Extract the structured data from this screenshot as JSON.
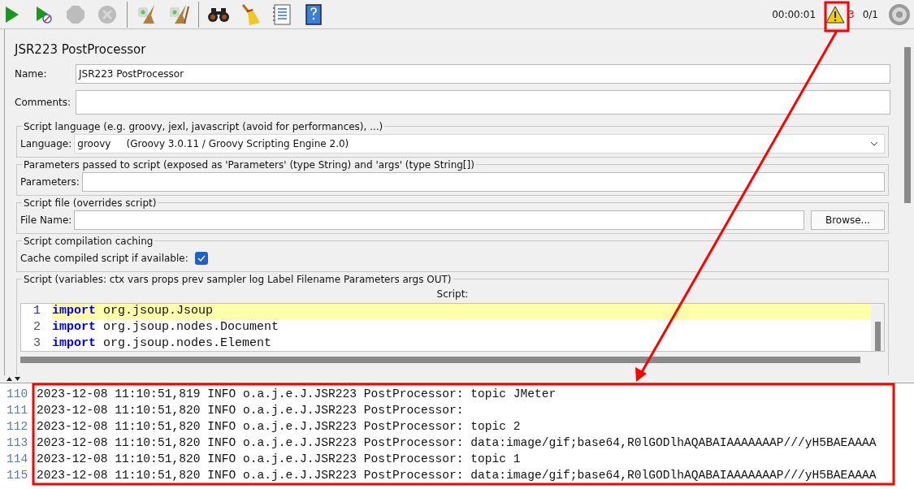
{
  "toolbar": {
    "buttons": [
      {
        "kind": "start",
        "disabled": false
      },
      {
        "kind": "start-no-pauses",
        "disabled": false
      },
      {
        "kind": "stop",
        "disabled": true
      },
      {
        "kind": "shutdown",
        "disabled": true
      },
      {
        "kind": "clear",
        "disabled": false
      },
      {
        "kind": "clear-all",
        "disabled": false
      },
      {
        "kind": "search",
        "disabled": false
      },
      {
        "kind": "reset",
        "disabled": false
      },
      {
        "kind": "log",
        "disabled": false
      },
      {
        "kind": "help",
        "disabled": false
      }
    ],
    "elapsed": "00:00:01",
    "warning_count": "3",
    "threads": "0/1"
  },
  "panel": {
    "title": "JSR223 PostProcessor",
    "name": {
      "label": "Name:",
      "value": "JSR223 PostProcessor"
    },
    "comments": {
      "label": "Comments:"
    },
    "language_group": {
      "title": "Script language (e.g. groovy, jexl, javascript (avoid for performances), ...)",
      "label": "Language:",
      "value": "groovy     (Groovy 3.0.11 / Groovy Scripting Engine 2.0)"
    },
    "parameters_group": {
      "title": "Parameters passed to script (exposed as 'Parameters' (type String) and 'args' (type String[])",
      "label": "Parameters:"
    },
    "file_group": {
      "title": "Script file (overrides script)",
      "label": "File Name:",
      "button": "Browse..."
    },
    "cache_group": {
      "title": "Script compilation caching",
      "label": "Cache compiled script if available:",
      "checked": true
    },
    "script_group": {
      "title": "Script (variables: ctx vars props prev sampler log Label Filename Parameters args OUT)",
      "caption": "Script:",
      "lines": [
        {
          "number": "1",
          "keyword": "import",
          "text": "org.jsoup.Jsoup",
          "current": true
        },
        {
          "number": "2",
          "keyword": "import",
          "text": "org.jsoup.nodes.Document",
          "current": false
        },
        {
          "number": "3",
          "keyword": "import",
          "text": "org.jsoup.nodes.Element",
          "current": false
        }
      ]
    }
  },
  "log": {
    "lines": [
      {
        "number": "110",
        "text": "2023-12-08 11:10:51,819 INFO o.a.j.e.J.JSR223 PostProcessor: topic JMeter"
      },
      {
        "number": "111",
        "text": "2023-12-08 11:10:51,820 INFO o.a.j.e.J.JSR223 PostProcessor:"
      },
      {
        "number": "112",
        "text": "2023-12-08 11:10:51,820 INFO o.a.j.e.J.JSR223 PostProcessor: topic 2"
      },
      {
        "number": "113",
        "text": "2023-12-08 11:10:51,820 INFO o.a.j.e.J.JSR223 PostProcessor: data:image/gif;base64,R0lGODlhAQABAIAAAAAAAP///yH5BAEAAAA"
      },
      {
        "number": "114",
        "text": "2023-12-08 11:10:51,820 INFO o.a.j.e.J.JSR223 PostProcessor: topic 1"
      },
      {
        "number": "115",
        "text": "2023-12-08 11:10:51,820 INFO o.a.j.e.J.JSR223 PostProcessor: data:image/gif;base64,R0lGODlhAQABAIAAAAAAAP///yH5BAEAAAA"
      }
    ]
  }
}
